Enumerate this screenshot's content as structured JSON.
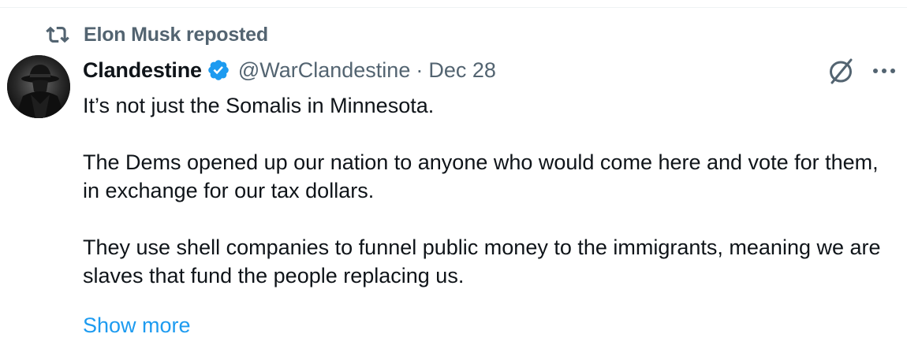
{
  "repost": {
    "icon": "repost-icon",
    "text": "Elon Musk reposted"
  },
  "author": {
    "avatar_icon": "avatar-silhouette",
    "display_name": "Clandestine",
    "verified_icon": "verified-badge-icon",
    "handle": "@WarClandestine",
    "separator": "·",
    "date": "Dec 28"
  },
  "actions": {
    "grok_icon": "grok-icon",
    "more_icon": "more-icon"
  },
  "tweet": {
    "paragraphs": [
      "It’s not just the Somalis in Minnesota.",
      "The Dems opened up our nation to anyone who would come here and vote for them, in exchange for our tax dollars.",
      "They use shell companies to funnel public money to the immigrants, meaning we are slaves that fund the people replacing us."
    ],
    "show_more": "Show more"
  },
  "colors": {
    "text_primary": "#0f1419",
    "text_secondary": "#536471",
    "link": "#1d9bf0",
    "verified": "#1d9bf0"
  }
}
